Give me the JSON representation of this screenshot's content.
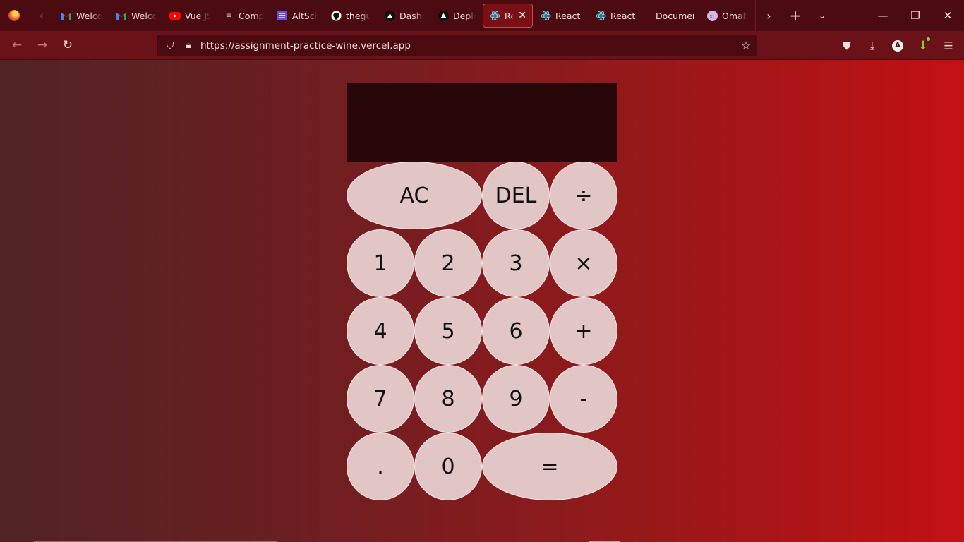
{
  "browser": {
    "tabs": [
      {
        "title": "Welco",
        "icon": "gmail-icon",
        "active": false
      },
      {
        "title": "Welco",
        "icon": "gmail-icon",
        "active": false
      },
      {
        "title": "Vue JS",
        "icon": "youtube-icon",
        "active": false
      },
      {
        "title": "Comp",
        "icon": "site-icon",
        "active": false
      },
      {
        "title": "AltSch",
        "icon": "list-icon",
        "active": false
      },
      {
        "title": "thegu",
        "icon": "github-icon",
        "active": false
      },
      {
        "title": "Dashb",
        "icon": "vercel-icon",
        "active": false
      },
      {
        "title": "Deplo",
        "icon": "vercel-icon",
        "active": false
      },
      {
        "title": "Rea",
        "icon": "react-icon",
        "active": true
      },
      {
        "title": "React",
        "icon": "react-icon",
        "active": false
      },
      {
        "title": "React",
        "icon": "react-icon",
        "active": false
      },
      {
        "title": "Document",
        "icon": "",
        "active": false
      },
      {
        "title": "Omah",
        "icon": "xl-icon",
        "active": false
      }
    ],
    "url": "https://assignment-practice-wine.vercel.app"
  },
  "calculator": {
    "display": "",
    "keys": [
      "AC",
      "DEL",
      "÷",
      "1",
      "2",
      "3",
      "×",
      "4",
      "5",
      "6",
      "+",
      "7",
      "8",
      "9",
      "-",
      ".",
      "0",
      "="
    ]
  }
}
